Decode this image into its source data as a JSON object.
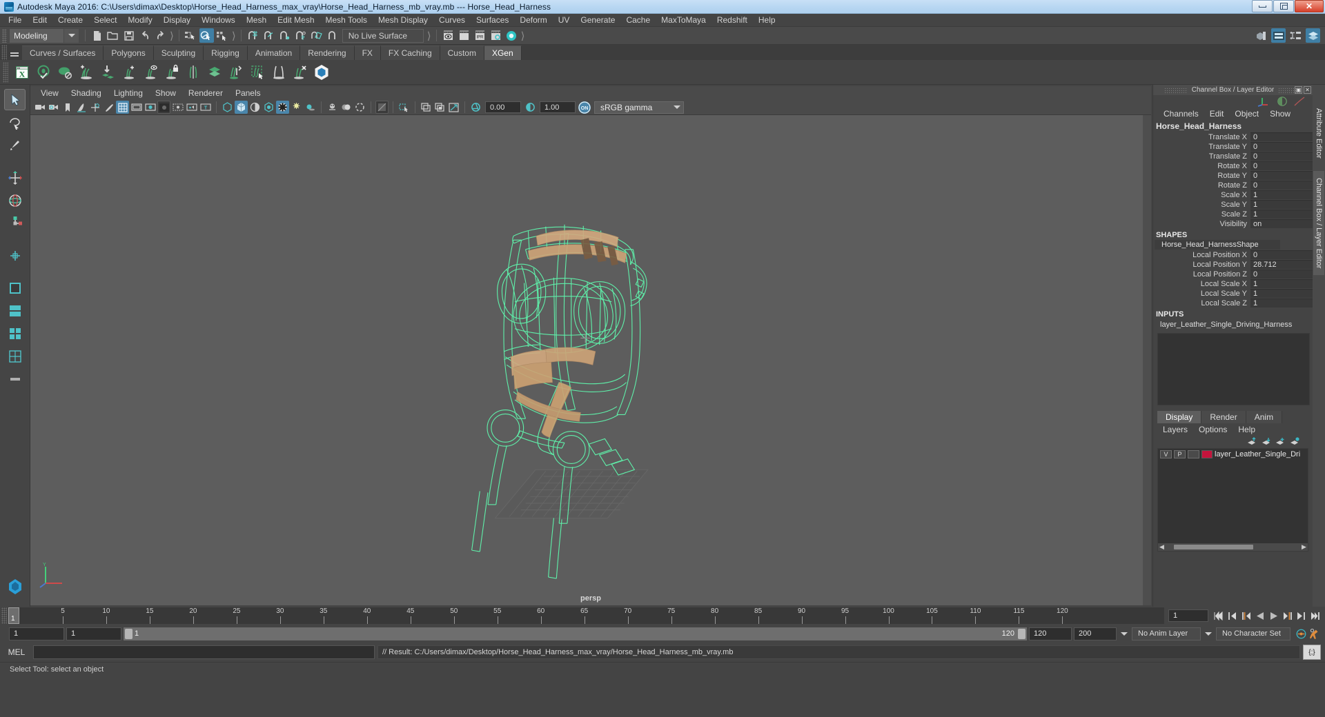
{
  "titlebar": {
    "title": "Autodesk Maya 2016: C:\\Users\\dimax\\Desktop\\Horse_Head_Harness_max_vray\\Horse_Head_Harness_mb_vray.mb   ---   Horse_Head_Harness",
    "minimize": "minimize",
    "restore": "restore",
    "close": "close"
  },
  "menubar": {
    "items": [
      "File",
      "Edit",
      "Create",
      "Select",
      "Modify",
      "Display",
      "Windows",
      "Mesh",
      "Edit Mesh",
      "Mesh Tools",
      "Mesh Display",
      "Curves",
      "Surfaces",
      "Deform",
      "UV",
      "Generate",
      "Cache",
      "MaxToMaya",
      "Redshift",
      "Help"
    ]
  },
  "toolbar": {
    "menuset": "Modeling",
    "live_surface": "No Live Surface",
    "icons": [
      "new-scene-icon",
      "open-scene-icon",
      "save-scene-icon",
      "undo-icon",
      "redo-icon",
      "select-hierarchy-icon",
      "select-object-icon",
      "select-component-icon",
      "snap-to-grid-icon",
      "snap-to-curve-icon",
      "snap-to-point-icon",
      "snap-to-projected-center-icon",
      "snap-to-view-plane-icon",
      "make-live-icon",
      "render-view-icon",
      "render-sequence-icon",
      "ipr-render-icon",
      "render-settings-icon",
      "hypershade-icon"
    ],
    "right_icons": [
      "show-manipulator-icon",
      "outliner-icon",
      "node-editor-icon",
      "attribute-editor-icon"
    ]
  },
  "shelf": {
    "tabs": [
      "Curves / Surfaces",
      "Polygons",
      "Sculpting",
      "Rigging",
      "Animation",
      "Rendering",
      "FX",
      "FX Caching",
      "Custom",
      "XGen"
    ],
    "active_tab": "XGen",
    "icons": [
      "xgen-editor-icon",
      "xgen-preview-icon",
      "xgen-disable-preview-icon",
      "xgen-add-groom-icon",
      "xgen-place-icon",
      "xgen-add-density-icon",
      "xgen-eye-density-icon",
      "xgen-lock-icon",
      "xgen-part-icon",
      "xgen-layers-icon",
      "xgen-noise-icon",
      "xgen-region-select-icon",
      "xgen-clump-icon",
      "xgen-remove-icon",
      "bifrost-icon"
    ]
  },
  "leftrail": {
    "tools": [
      "select-tool",
      "lasso-select-tool",
      "paint-select-tool",
      "move-tool",
      "rotate-tool",
      "scale-tool",
      "soft-select-tool",
      "last-tool",
      "snap-magnet-icon",
      "move-snap-icon",
      "rotate-snap-icon",
      "scale-snap-icon",
      "layout-single-icon",
      "layout-two-pane-icon",
      "layout-four-pane-icon",
      "layout-persp-icon",
      "maya-logo-icon"
    ]
  },
  "viewport": {
    "panel_menus": [
      "View",
      "Shading",
      "Lighting",
      "Show",
      "Renderer",
      "Panels"
    ],
    "exposure": "0.00",
    "gamma": "1.00",
    "color_profile": "sRGB gamma",
    "camera_label": "persp",
    "panel_icons": [
      "camera-icon",
      "camera-attributes-icon",
      "bookmark-icon",
      "image-plane-icon",
      "2d-pan-zoom-icon",
      "grease-pencil-icon",
      "grid-icon",
      "film-gate-icon",
      "resolution-gate-icon",
      "gate-mask-icon",
      "field-chart-icon",
      "safe-action-icon",
      "safe-title-icon",
      "wireframe-icon",
      "smooth-shade-icon",
      "shaded-wireframe-icon",
      "textured-icon",
      "use-all-lights-icon",
      "shadows-icon",
      "screen-space-ao-icon",
      "motion-blur-icon",
      "multisample-icon",
      "isolate-select-icon",
      "xray-icon",
      "xray-joints-icon",
      "xray-active-components-icon",
      "exposure-icon",
      "gamma-icon",
      "color-management-on-icon"
    ]
  },
  "channelbox": {
    "panel_title": "Channel Box / Layer Editor",
    "menus": [
      "Channels",
      "Edit",
      "Object",
      "Show"
    ],
    "object_name": "Horse_Head_Harness",
    "transform_attrs": [
      {
        "label": "Translate X",
        "value": "0"
      },
      {
        "label": "Translate Y",
        "value": "0"
      },
      {
        "label": "Translate Z",
        "value": "0"
      },
      {
        "label": "Rotate X",
        "value": "0"
      },
      {
        "label": "Rotate Y",
        "value": "0"
      },
      {
        "label": "Rotate Z",
        "value": "0"
      },
      {
        "label": "Scale X",
        "value": "1"
      },
      {
        "label": "Scale Y",
        "value": "1"
      },
      {
        "label": "Scale Z",
        "value": "1"
      },
      {
        "label": "Visibility",
        "value": "on"
      }
    ],
    "shapes_label": "SHAPES",
    "shape_name": "Horse_Head_HarnessShape",
    "shape_attrs": [
      {
        "label": "Local Position X",
        "value": "0"
      },
      {
        "label": "Local Position Y",
        "value": "28.712"
      },
      {
        "label": "Local Position Z",
        "value": "0"
      },
      {
        "label": "Local Scale X",
        "value": "1"
      },
      {
        "label": "Local Scale Y",
        "value": "1"
      },
      {
        "label": "Local Scale Z",
        "value": "1"
      }
    ],
    "inputs_label": "INPUTS",
    "input_name": "layer_Leather_Single_Driving_Harness"
  },
  "layereditor": {
    "tabs": [
      "Display",
      "Render",
      "Anim"
    ],
    "active_tab": "Display",
    "menus": [
      "Layers",
      "Options",
      "Help"
    ],
    "buttons": [
      "move-layer-up-icon",
      "move-layer-down-icon",
      "create-new-layer-icon",
      "create-layer-from-selected-icon"
    ],
    "layers": [
      {
        "visibility": "V",
        "playback": "P",
        "shading": "",
        "color": "#c4143c",
        "name": "layer_Leather_Single_Dri"
      }
    ]
  },
  "docktabs": {
    "items": [
      "Attribute Editor",
      "Channel Box / Layer Editor"
    ]
  },
  "timeline": {
    "current_frame": "1",
    "start_field": "1",
    "ticks": [
      5,
      10,
      15,
      20,
      25,
      30,
      35,
      40,
      45,
      50,
      55,
      60,
      65,
      70,
      75,
      80,
      85,
      90,
      95,
      100,
      105,
      110,
      115,
      120
    ],
    "end_label": "120",
    "playback_field": "1",
    "transport": [
      "go-to-start-icon",
      "step-back-keyframe-icon",
      "step-back-frame-icon",
      "play-backwards-icon",
      "play-forwards-icon",
      "step-forward-frame-icon",
      "step-forward-keyframe-icon",
      "go-to-end-icon"
    ]
  },
  "rangeslider": {
    "anim_start": "1",
    "range_start": "1",
    "bar_start": "1",
    "bar_end": "120",
    "range_end": "120",
    "anim_end": "200",
    "anim_layer": "No Anim Layer",
    "character_set": "No Character Set",
    "right_icons": [
      "auto-keyframe-icon",
      "animation-preferences-icon"
    ]
  },
  "mel": {
    "label": "MEL",
    "input_value": "",
    "result_text": "// Result: C:/Users/dimax/Desktop/Horse_Head_Harness_max_vray/Horse_Head_Harness_mb_vray.mb",
    "script_editor_icon": "script-editor-icon"
  },
  "helpline": {
    "text": "Select Tool: select an object"
  },
  "colors": {
    "accent": "#4a86ab",
    "mesh_green": "#55f0a8",
    "mesh_tan": "#d6a982",
    "layer_red": "#c4143c",
    "panel_bg": "#444444",
    "viewport_bg": "#5d5d5d"
  }
}
